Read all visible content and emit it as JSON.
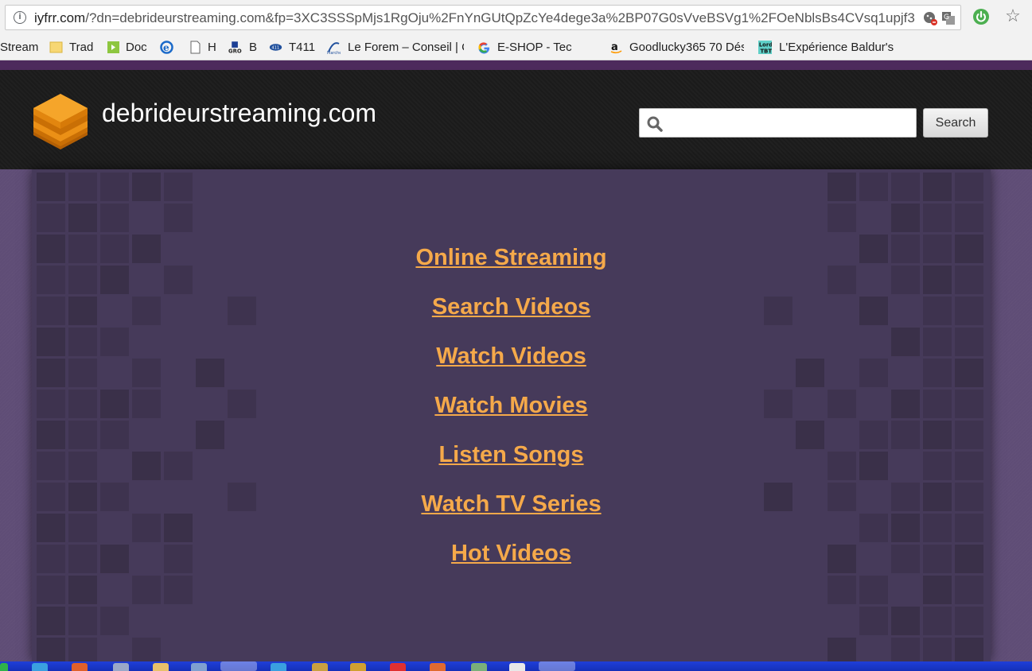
{
  "browser": {
    "url_host": "iyfrr.com",
    "url_rest": "/?dn=debrideurstreaming.com&fp=3XC3SSSpMjs1RgOju%2FnYnGUtQpZcYe4dege3a%2BP07G0sVveBSVg1%2FOeNblsBs4CVsq1upjf3",
    "bookmarks": [
      {
        "label": "Stream",
        "icon": "none"
      },
      {
        "label": "Trad",
        "icon": "folder-icon"
      },
      {
        "label": "Doc",
        "icon": "doc-app-icon"
      },
      {
        "label": "",
        "icon": "ie-icon"
      },
      {
        "label": "H",
        "icon": "page-icon"
      },
      {
        "label": "B",
        "icon": "gro-icon"
      },
      {
        "label": "T411",
        "icon": "t411-icon"
      },
      {
        "label": "Le Forem – Conseil | C",
        "icon": "forem-icon"
      },
      {
        "label": "E-SHOP - Tec",
        "icon": "google-icon"
      },
      {
        "label": "Goodlucky365 70 Dés",
        "icon": "amazon-icon"
      },
      {
        "label": "L'Expérience Baldur's G",
        "icon": "lord-icon"
      }
    ]
  },
  "site": {
    "title": "debrideurstreaming.com",
    "search": {
      "placeholder": "",
      "value": "",
      "button_label": "Search"
    },
    "nav_links": [
      "Online Streaming",
      "Search Videos",
      "Watch Videos",
      "Watch Movies",
      "Listen Songs",
      "Watch TV Series",
      "Hot Videos"
    ],
    "colors": {
      "link": "#f5a94a",
      "header": "#1b1b1b",
      "panel": "#463a5a",
      "accent_strip": "#4d2a5c"
    }
  }
}
